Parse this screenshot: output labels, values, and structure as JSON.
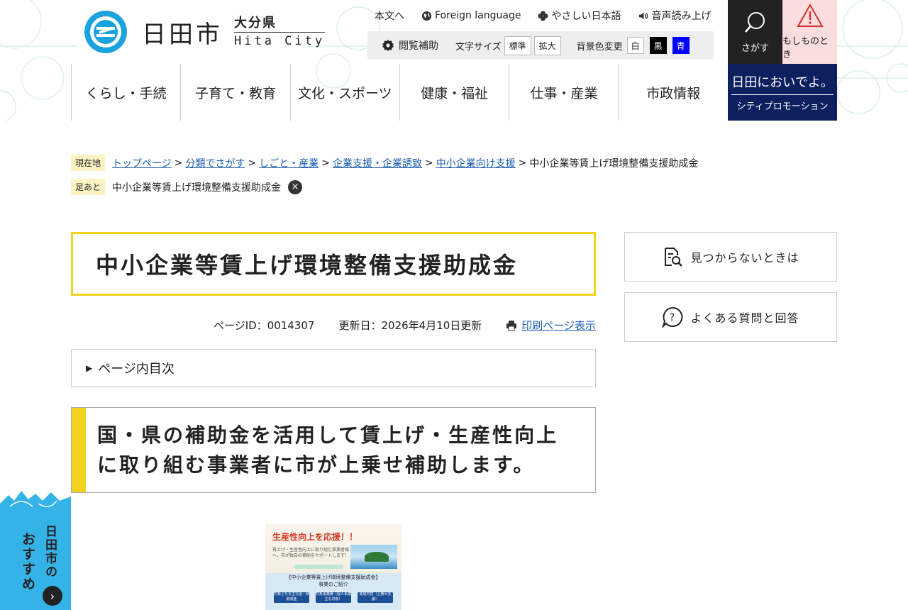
{
  "header": {
    "city_name": "日田市",
    "prefecture": "大分県",
    "city_en": "Hita City",
    "util_links": {
      "honbun": "本文へ",
      "foreign": "Foreign language",
      "yasashii": "やさしい日本語",
      "voice": "音声読み上げ"
    },
    "a11y": {
      "assist_label": "閲覧補助",
      "font_size_label": "文字サイズ",
      "standard": "標準",
      "enlarge": "拡大",
      "bg_label": "背景色変更",
      "white": "白",
      "black": "黒",
      "blue": "青"
    },
    "search_label": "さがす",
    "emergency_label": "もしものとき"
  },
  "gnav": [
    "くらし・手続",
    "子育て・教育",
    "文化・スポーツ",
    "健康・福祉",
    "仕事・産業",
    "市政情報"
  ],
  "promo": {
    "main": "日田においでよ。",
    "sub": "シティプロモーション"
  },
  "breadcrumb": {
    "badge": "現在地",
    "links": [
      "トップページ",
      "分類でさがす",
      "しごと・産業",
      "企業支援・企業誘致",
      "中小企業向け支援"
    ],
    "current": "中小企業等賃上げ環境整備支援助成金"
  },
  "footprint": {
    "badge": "足あと",
    "item": "中小企業等賃上げ環境整備支援助成金",
    "close": "×"
  },
  "page": {
    "title": "中小企業等賃上げ環境整備支援助成金",
    "page_id": "ページID：0014307",
    "updated": "更新日：2026年4月10日更新",
    "print": "印刷ページ表示",
    "toc": "ページ内目次",
    "heading_line1": "国・県の補助金を活用して賃上げ・生産性向上",
    "heading_line2": "に取り組む事業者に市が上乗せ補助します。"
  },
  "flyer": {
    "title": "生産性向上を応援！！",
    "small": "賃上げ・生産性向上に取り組む事業者様へ、市が独自の補助をサポートします！",
    "head1": "【中小企業等賃上げ環境整備支援助成金】",
    "head2": "事業のご紹介",
    "chip1": "対象となる主な国・県助成金",
    "chip2": "対象事業費（個人事業主も対象）",
    "chip3": "助成内容（上乗せ支援）"
  },
  "sidebar": {
    "not_found": "見つからないときは",
    "faq": "よくある質問と回答"
  },
  "osusume": {
    "line1": "日田市の",
    "line2": "おすすめ",
    "arrow": "›"
  },
  "colors": {
    "accent_yellow": "#f2d11f",
    "link_blue": "#1a5db0",
    "promo_navy": "#0d1f5e",
    "osusume_blue": "#33b3e8",
    "emergency_pink": "#fadddd"
  }
}
